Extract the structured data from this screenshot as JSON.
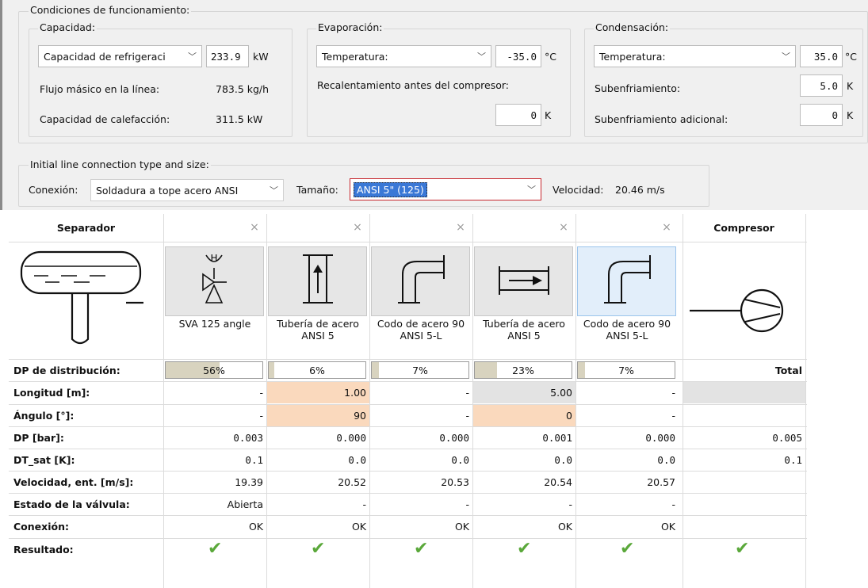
{
  "operating": {
    "legend": "Condiciones de funcionamiento:",
    "capacity": {
      "legend": "Capacidad:",
      "select": "Capacidad de refrigeraci",
      "value": "233.9",
      "unit": "kW",
      "mass_flow_label": "Flujo másico en la línea:",
      "mass_flow_value": "783.5 kg/h",
      "heating_label": "Capacidad de calefacción:",
      "heating_value": "311.5 kW"
    },
    "evaporation": {
      "legend": "Evaporación:",
      "select": "Temperatura:",
      "value": "-35.0",
      "unit": "°C",
      "superheat_label": "Recalentamiento antes del compresor:",
      "superheat_value": "0",
      "superheat_unit": "K"
    },
    "condensation": {
      "legend": "Condensación:",
      "select": "Temperatura:",
      "value": "35.0",
      "unit": "°C",
      "subcool_label": "Subenfriamiento:",
      "subcool_value": "5.0",
      "subcool_unit": "K",
      "extra_subcool_label": "Subenfriamiento adicional:",
      "extra_subcool_value": "0",
      "extra_subcool_unit": "K"
    }
  },
  "line": {
    "legend": "Initial line connection type and size:",
    "connection_label": "Conexión:",
    "connection_value": "Soldadura a tope acero ANSI",
    "size_label": "Tamaño:",
    "size_value": "ANSI 5\" (125)",
    "velocity_label": "Velocidad:",
    "velocity_value": "20.46 m/s"
  },
  "table": {
    "start_header": "Separador",
    "end_header": "Compresor",
    "remove_symbol": "×",
    "components": [
      {
        "name": "SVA 125 angle",
        "icon": "angle-valve-icon",
        "dist": "56%",
        "dist_fill": 0.56,
        "length": "-",
        "angle": "-",
        "dp": "0.003",
        "dt": "0.1",
        "vel": "19.39",
        "valve": "Abierta",
        "conn": "OK"
      },
      {
        "name": "Tubería de acero ANSI 5",
        "icon": "vertical-pipe-icon",
        "dist": "6%",
        "dist_fill": 0.06,
        "length": "1.00",
        "angle": "90",
        "dp": "0.000",
        "dt": "0.0",
        "vel": "20.52",
        "valve": "-",
        "conn": "OK"
      },
      {
        "name": "Codo de acero 90 ANSI 5-L",
        "icon": "elbow-icon",
        "dist": "7%",
        "dist_fill": 0.07,
        "length": "-",
        "angle": "-",
        "dp": "0.000",
        "dt": "0.0",
        "vel": "20.53",
        "valve": "-",
        "conn": "OK"
      },
      {
        "name": "Tubería de acero ANSI 5",
        "icon": "horizontal-pipe-icon",
        "dist": "23%",
        "dist_fill": 0.23,
        "length": "5.00",
        "angle": "0",
        "dp": "0.001",
        "dt": "0.0",
        "vel": "20.54",
        "valve": "-",
        "conn": "OK"
      },
      {
        "name": "Codo de acero 90 ANSI 5-L",
        "icon": "elbow-icon",
        "dist": "7%",
        "dist_fill": 0.07,
        "length": "-",
        "angle": "-",
        "dp": "0.000",
        "dt": "0.0",
        "vel": "20.57",
        "valve": "-",
        "conn": "OK"
      }
    ],
    "rows": {
      "dist": "DP de distribución:",
      "length": "Longitud [m]:",
      "angle": "Ángulo [°]:",
      "dp": "DP [bar]:",
      "dt": "DT_sat [K]:",
      "vel": "Velocidad, ent. [m/s]:",
      "valve": "Estado de la válvula:",
      "conn": "Conexión:",
      "result": "Resultado:"
    },
    "total_header": "Total",
    "total_dp": "0.005",
    "total_dt": "0.1",
    "result_symbol": "✔"
  },
  "colors": {
    "edit_highlight": "#fad9bd",
    "readonly_gray": "#e3e3e3",
    "check": "#5aa83a",
    "selection": "#3a78d6"
  }
}
